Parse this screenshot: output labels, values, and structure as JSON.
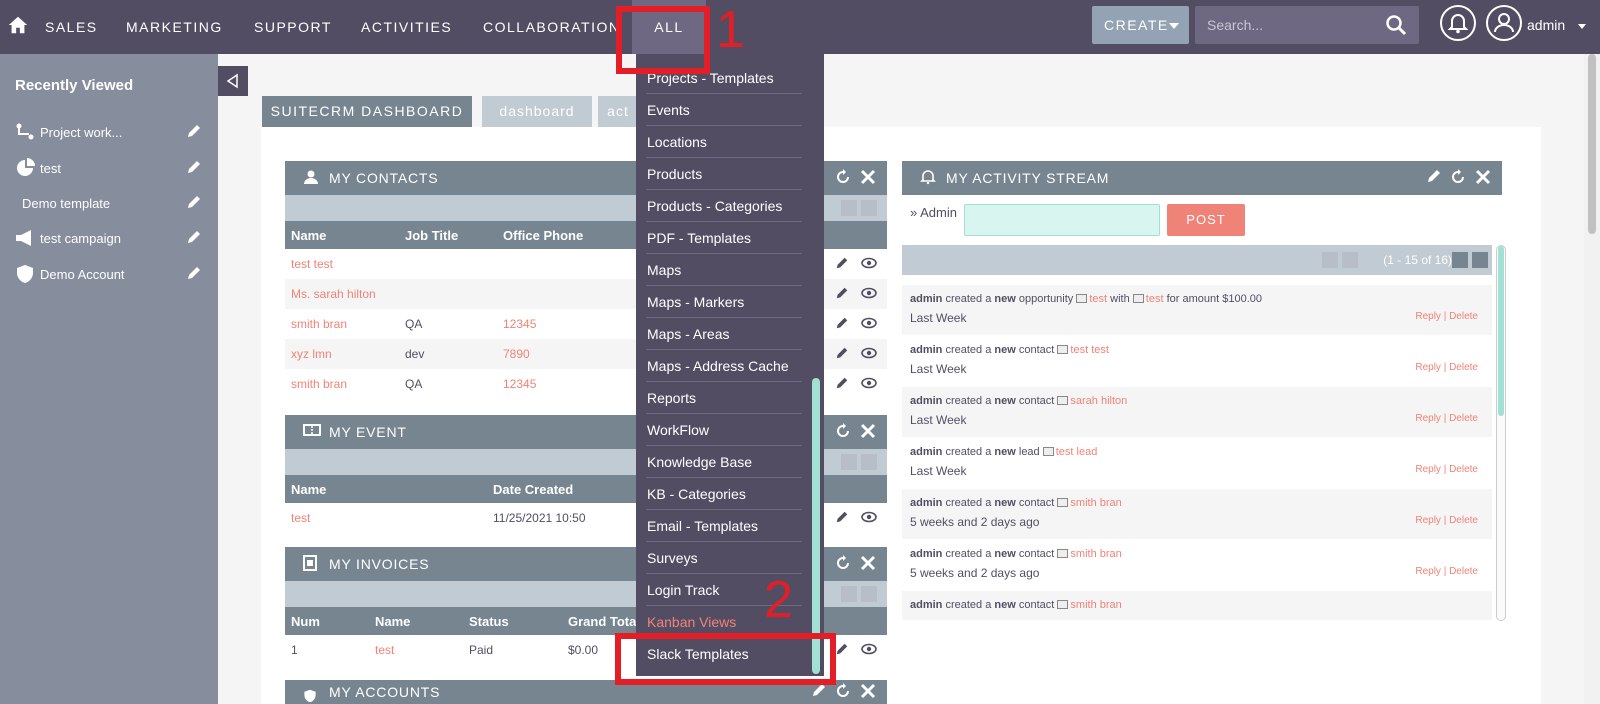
{
  "nav": {
    "items": [
      "SALES",
      "MARKETING",
      "SUPPORT",
      "ACTIVITIES",
      "COLLABORATION",
      "ALL"
    ],
    "create_label": "CREATE",
    "search_placeholder": "Search...",
    "user_name": "admin"
  },
  "sidebar": {
    "title": "Recently Viewed",
    "items": [
      {
        "label": "Project work...",
        "icon": "project-icon"
      },
      {
        "label": "test",
        "icon": "pie-chart-icon"
      },
      {
        "label": "Demo template",
        "icon": "none"
      },
      {
        "label": "test campaign",
        "icon": "megaphone-icon"
      },
      {
        "label": "Demo Account",
        "icon": "shield-icon"
      }
    ]
  },
  "tabs": [
    "SUITECRM DASHBOARD",
    "dashboard",
    "act"
  ],
  "contacts": {
    "title": "MY CONTACTS",
    "columns": [
      "Name",
      "Job Title",
      "Office Phone"
    ],
    "rows": [
      {
        "name": "test test",
        "job": "",
        "phone": ""
      },
      {
        "name": "Ms. sarah hilton",
        "job": "",
        "phone": ""
      },
      {
        "name": "smith bran",
        "job": "QA",
        "phone": "12345"
      },
      {
        "name": "xyz lmn",
        "job": "dev",
        "phone": "7890"
      },
      {
        "name": "smith bran",
        "job": "QA",
        "phone": "12345"
      }
    ]
  },
  "event": {
    "title": "MY EVENT",
    "columns": [
      "Name",
      "Date Created"
    ],
    "rows": [
      {
        "name": "test",
        "date": "11/25/2021 10:50"
      }
    ]
  },
  "invoices": {
    "title": "MY INVOICES",
    "columns": [
      "Num",
      "Name",
      "Status",
      "Grand Total"
    ],
    "rows": [
      {
        "num": "1",
        "name": "test",
        "status": "Paid",
        "total": "$0.00"
      }
    ]
  },
  "accounts": {
    "title": "MY ACCOUNTS"
  },
  "stream": {
    "title": "MY ACTIVITY STREAM",
    "composer_label": "Admin",
    "post_label": "POST",
    "pager": "(1 - 15 of 16)",
    "reply_delete": "Reply | Delete",
    "entries": [
      {
        "who": "admin",
        "action": "created a",
        "kind": "new",
        "type": "opportunity",
        "target": "test",
        "extra1": "with",
        "target2": "test",
        "extra2": "for amount $100.00",
        "when": "Last Week"
      },
      {
        "who": "admin",
        "action": "created a",
        "kind": "new",
        "type": "contact",
        "target": "test test",
        "when": "Last Week"
      },
      {
        "who": "admin",
        "action": "created a",
        "kind": "new",
        "type": "contact",
        "target": "sarah hilton",
        "when": "Last Week"
      },
      {
        "who": "admin",
        "action": "created a",
        "kind": "new",
        "type": "lead",
        "target": "test lead",
        "when": "Last Week"
      },
      {
        "who": "admin",
        "action": "created a",
        "kind": "new",
        "type": "contact",
        "target": "smith bran",
        "when": "5 weeks and 2 days ago"
      },
      {
        "who": "admin",
        "action": "created a",
        "kind": "new",
        "type": "contact",
        "target": "smith bran",
        "when": "5 weeks and 2 days ago"
      },
      {
        "who": "admin",
        "action": "created a",
        "kind": "new",
        "type": "contact",
        "target": "smith bran",
        "when": ""
      }
    ]
  },
  "dropdown": {
    "items": [
      "Projects - Templates",
      "Events",
      "Locations",
      "Products",
      "Products - Categories",
      "PDF - Templates",
      "Maps",
      "Maps - Markers",
      "Maps - Areas",
      "Maps - Address Cache",
      "Reports",
      "WorkFlow",
      "Knowledge Base",
      "KB - Categories",
      "Email - Templates",
      "Surveys",
      "Login Track",
      "Kanban Views",
      "Slack Templates"
    ]
  },
  "annotations": {
    "label1": "1",
    "label2": "2"
  },
  "colors": {
    "nav": "#534d64",
    "accent": "#f08377",
    "header": "#778591",
    "annotation": "#e41e26"
  }
}
